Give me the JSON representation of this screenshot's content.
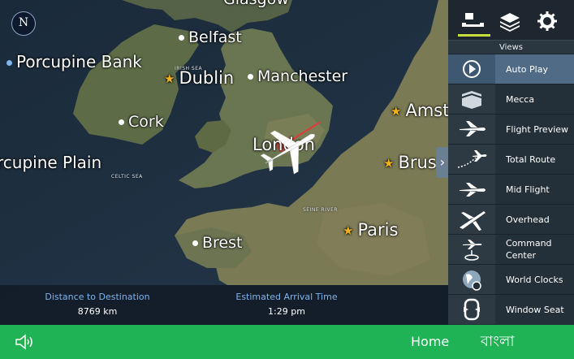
{
  "map": {
    "compass": "N",
    "places": {
      "porcupine_bank": "Porcupine  Bank",
      "porcupine_plain": "rcupine   Plain",
      "belfast": "Belfast",
      "dublin": "Dublin",
      "manchester": "Manchester",
      "cork": "Cork",
      "london": "London",
      "amsterdam": "Amst",
      "brussels": "Brus",
      "paris": "Paris",
      "brest": "Brest",
      "glasgow": "Glasgow"
    },
    "water": {
      "irish_sea": "IRISH SEA",
      "celtic_sea": "CELTIC SEA",
      "seine_river": "SEINE RIVER"
    }
  },
  "info": {
    "distance_label": "Distance to Destination",
    "distance_value": "8769",
    "distance_unit": "km",
    "eta_label": "Estimated Arrival Time",
    "eta_value": "1:29",
    "eta_unit": "pm"
  },
  "panel": {
    "title": "Views",
    "tabs": [
      "views-icon",
      "layers-icon",
      "gear-icon"
    ],
    "items": [
      {
        "label": "Auto Play",
        "icon": "play-icon"
      },
      {
        "label": "Mecca",
        "icon": "kaaba-icon"
      },
      {
        "label": "Flight Preview",
        "icon": "plane-icon"
      },
      {
        "label": "Total Route",
        "icon": "route-icon"
      },
      {
        "label": "Mid Flight",
        "icon": "plane-icon"
      },
      {
        "label": "Overhead",
        "icon": "plane-overhead-icon"
      },
      {
        "label": "Command\nCenter",
        "icon": "command-center-icon"
      },
      {
        "label": "World Clocks",
        "icon": "globe-clock-icon"
      },
      {
        "label": "Window Seat",
        "icon": "window-icon"
      }
    ]
  },
  "bottom": {
    "home": "Home",
    "language": "বাংলা"
  },
  "colors": {
    "bottom_bar": "#1fb355",
    "info_label": "#7fb3ee",
    "active_row": "#4f6b86",
    "tab_underline": "#c6dd3a",
    "star": "#f2b21b"
  }
}
